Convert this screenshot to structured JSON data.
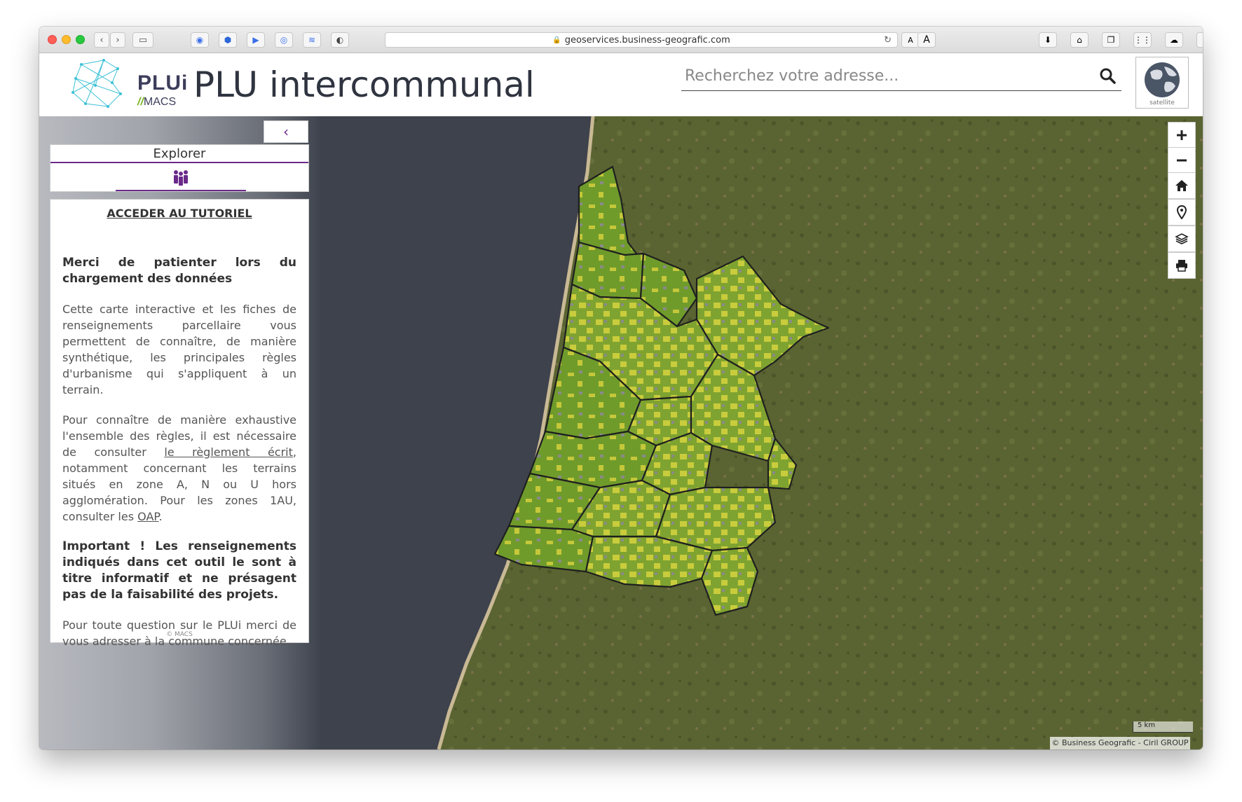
{
  "browser": {
    "url": "geoservices.business-geografic.com"
  },
  "header": {
    "logo_text": "PLUi",
    "logo_sub": "MACS",
    "title": "PLU intercommunal",
    "search_placeholder": "Recherchez votre adresse...",
    "basemap_label": "satellite"
  },
  "sidebar": {
    "tab_label": "Explorer",
    "tutorial_link": "ACCEDER AU TUTORIEL",
    "loading_title": "Merci de patienter lors du chargement des données",
    "para1": "Cette carte interactive et les fiches de renseignements parcellaire vous permettent de connaître, de manière synthétique, les principales règles d'urbanisme qui s'appliquent à un terrain.",
    "para2_a": "Pour connaître de manière exhaustive l'ensemble des règles, il est nécessaire de consulter ",
    "para2_link1": "le règlement écrit",
    "para2_b": ", notamment concernant les terrains situés en zone A, N ou U hors agglomération. Pour les zones 1AU, consulter les ",
    "para2_link2": "OAP",
    "para2_c": ".",
    "important": "Important ! Les renseignements indiqués dans cet outil le sont à titre informatif et ne présagent pas de la faisabilité des projets.",
    "para3": "Pour toute question sur le PLUi merci de vous adresser à la commune concernée.",
    "copyright": "© MACS"
  },
  "map": {
    "scale_label": "5 km",
    "attribution": "© Business Geografic - Ciril GROUP",
    "controls": [
      "plus-icon",
      "minus-icon",
      "home-icon",
      "location-pin-icon",
      "layers-icon",
      "print-icon"
    ]
  },
  "colors": {
    "accent": "#6b2a8a",
    "ocean": "#3e424c",
    "land": "#56602f",
    "zone_green": "#6e9a2a",
    "zone_yellow": "#c3c73a"
  }
}
